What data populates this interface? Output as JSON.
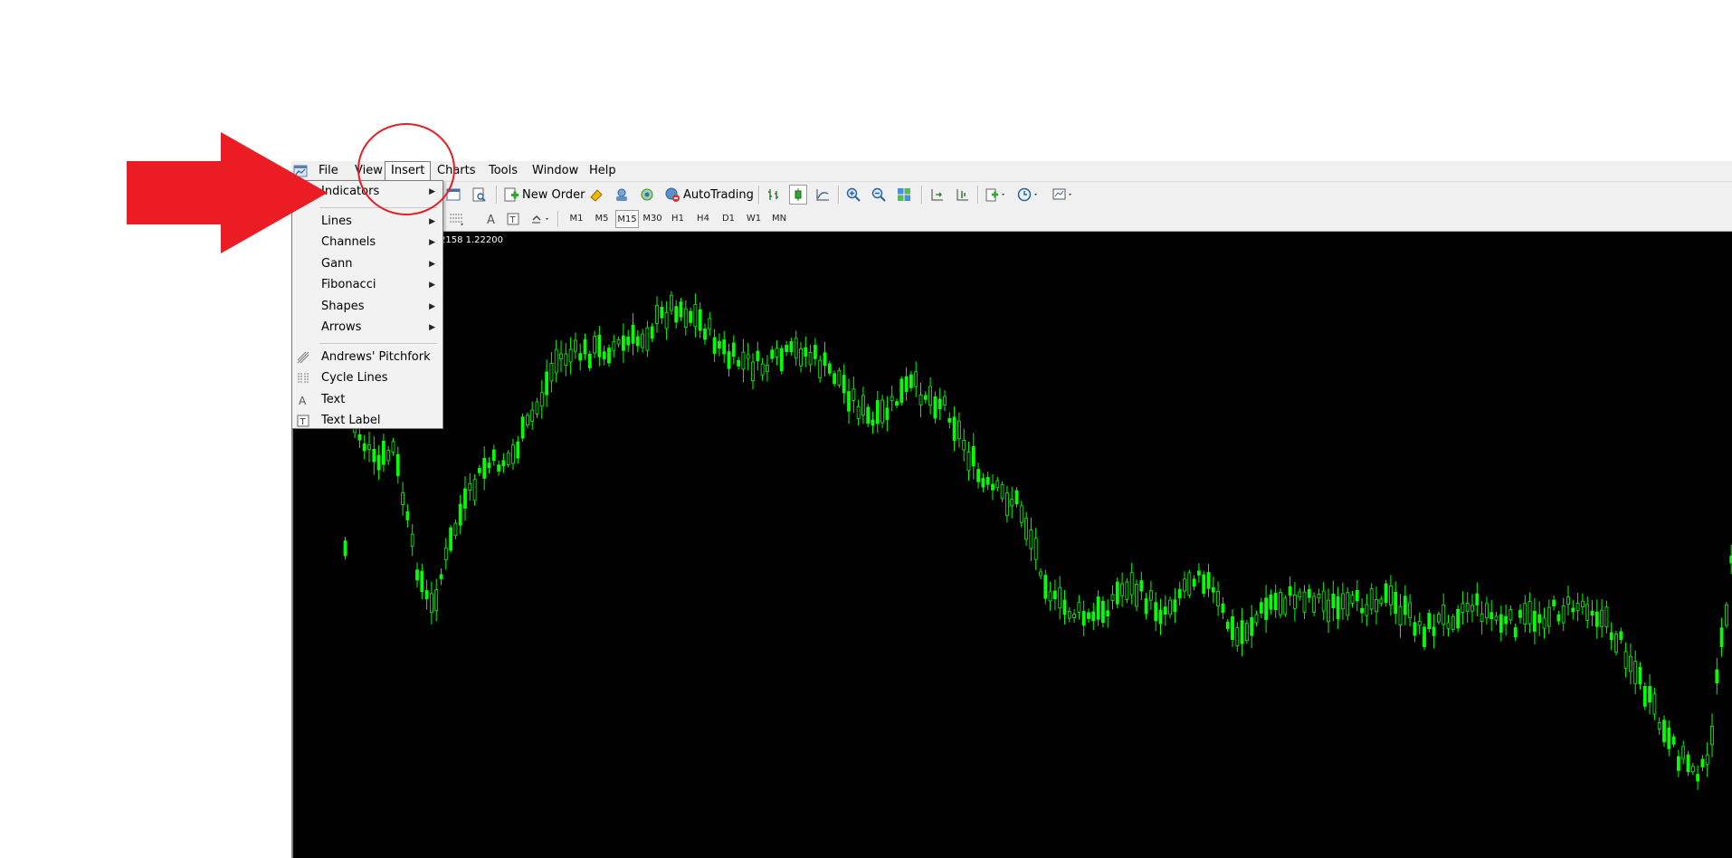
{
  "menubar": {
    "items": [
      "File",
      "View",
      "Insert",
      "Charts",
      "Tools",
      "Window",
      "Help"
    ],
    "active": "Insert"
  },
  "toolbar": {
    "new_order": "New Order",
    "autotrading": "AutoTrading",
    "timeframes": [
      "M1",
      "M5",
      "M15",
      "M30",
      "H1",
      "H4",
      "D1",
      "W1",
      "MN"
    ],
    "active_timeframe": "M15"
  },
  "chart": {
    "info": "2158 1.22200",
    "background": "#000000",
    "candle_color": "#00ff00"
  },
  "insert_menu": {
    "groups": [
      [
        {
          "label": "Indicators",
          "submenu": true,
          "icon": ""
        }
      ],
      [
        {
          "label": "Lines",
          "submenu": true,
          "icon": ""
        },
        {
          "label": "Channels",
          "submenu": true,
          "icon": ""
        },
        {
          "label": "Gann",
          "submenu": true,
          "icon": ""
        },
        {
          "label": "Fibonacci",
          "submenu": true,
          "icon": ""
        },
        {
          "label": "Shapes",
          "submenu": true,
          "icon": ""
        },
        {
          "label": "Arrows",
          "submenu": true,
          "icon": ""
        }
      ],
      [
        {
          "label": "Andrews' Pitchfork",
          "submenu": false,
          "icon": "pitchfork-icon"
        },
        {
          "label": "Cycle Lines",
          "submenu": false,
          "icon": "cycle-lines-icon"
        },
        {
          "label": "Text",
          "submenu": false,
          "icon": "text-icon"
        },
        {
          "label": "Text Label",
          "submenu": false,
          "icon": "text-label-icon"
        }
      ]
    ]
  },
  "annotations": {
    "arrow_color": "#ec1c24",
    "circle_color": "#e31e24"
  }
}
